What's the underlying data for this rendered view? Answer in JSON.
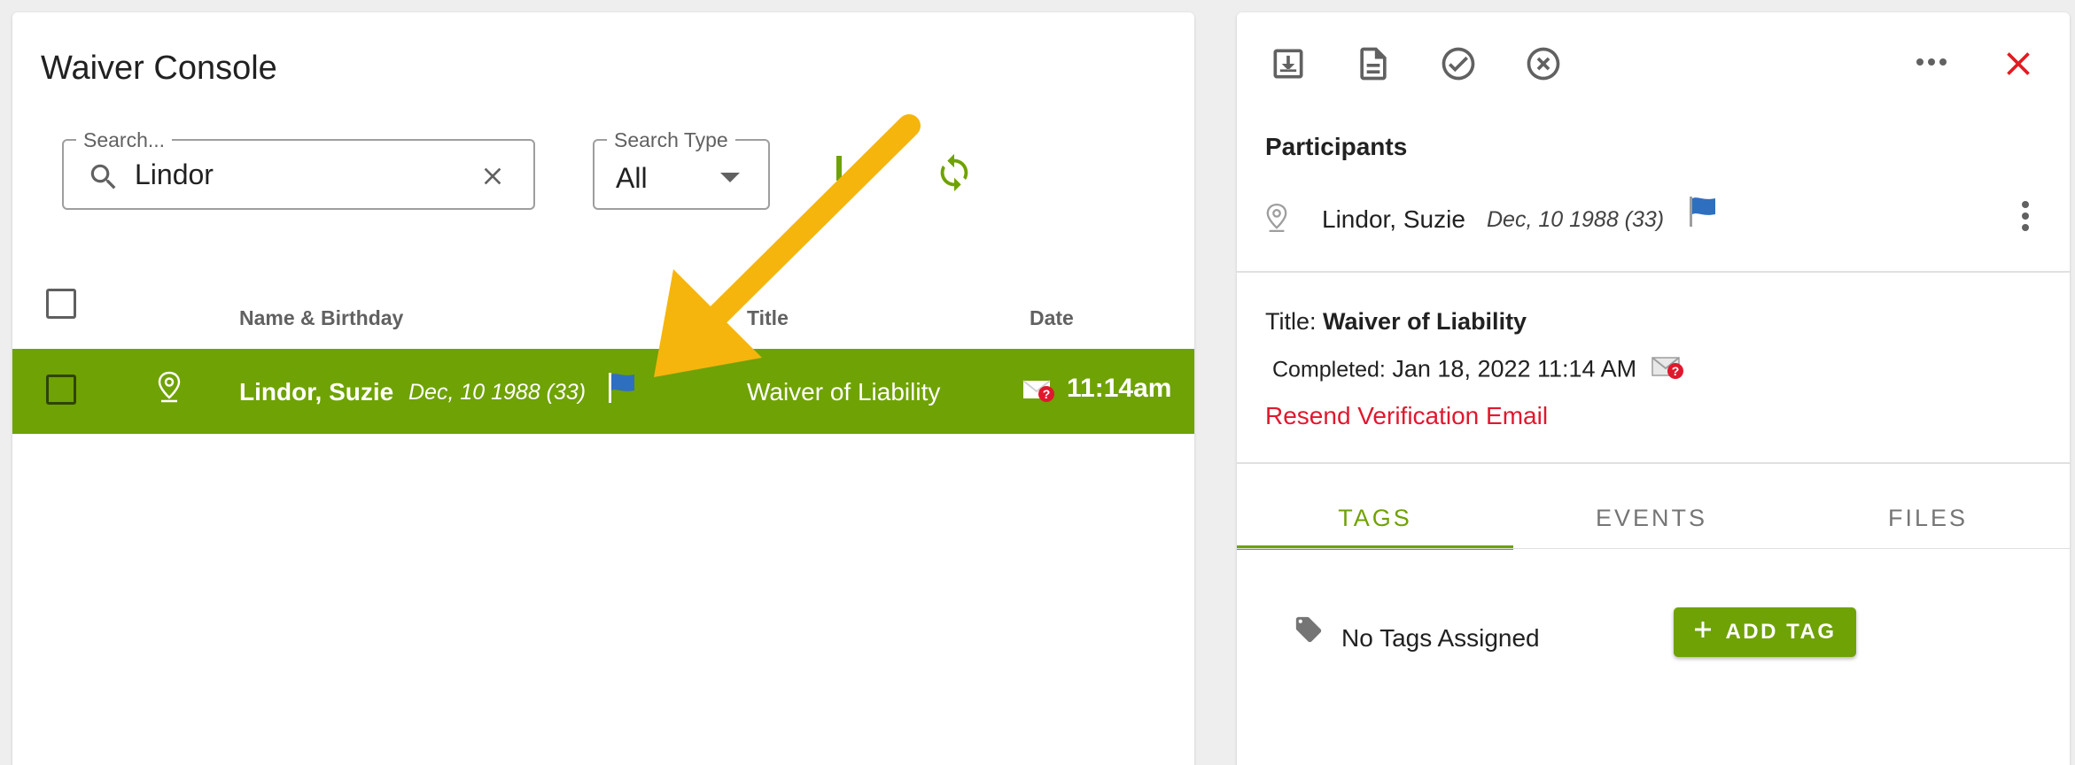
{
  "console": {
    "title": "Waiver Console",
    "search": {
      "legend": "Search...",
      "value": "Lindor"
    },
    "search_type": {
      "legend": "Search Type",
      "value": "All"
    }
  },
  "table": {
    "columns": [
      "Name & Birthday",
      "Title",
      "Date"
    ],
    "rows": [
      {
        "name": "Lindor, Suzie",
        "dob": "Dec, 10 1988 (33)",
        "title": "Waiver of Liability",
        "time": "11:14am",
        "selected": true
      }
    ]
  },
  "detail": {
    "participants_heading": "Participants",
    "participant": {
      "name": "Lindor, Suzie",
      "dob": "Dec, 10 1988 (33)"
    },
    "title_label": "Title:",
    "title_value": "Waiver of Liability",
    "completed_label": "Completed:",
    "completed_value": "Jan 18, 2022 11:14 AM",
    "resend_link": "Resend Verification Email",
    "tabs": [
      {
        "label": "TAGS",
        "active": true
      },
      {
        "label": "EVENTS",
        "active": false
      },
      {
        "label": "FILES",
        "active": false
      }
    ],
    "no_tags": "No Tags Assigned",
    "add_tag_label": "ADD TAG"
  },
  "colors": {
    "accent_green": "#6fa204",
    "link_red": "#e0182d",
    "close_red": "#e31b23",
    "flag_blue": "#2f6fbf",
    "annotation_arrow": "#f5b50c"
  }
}
